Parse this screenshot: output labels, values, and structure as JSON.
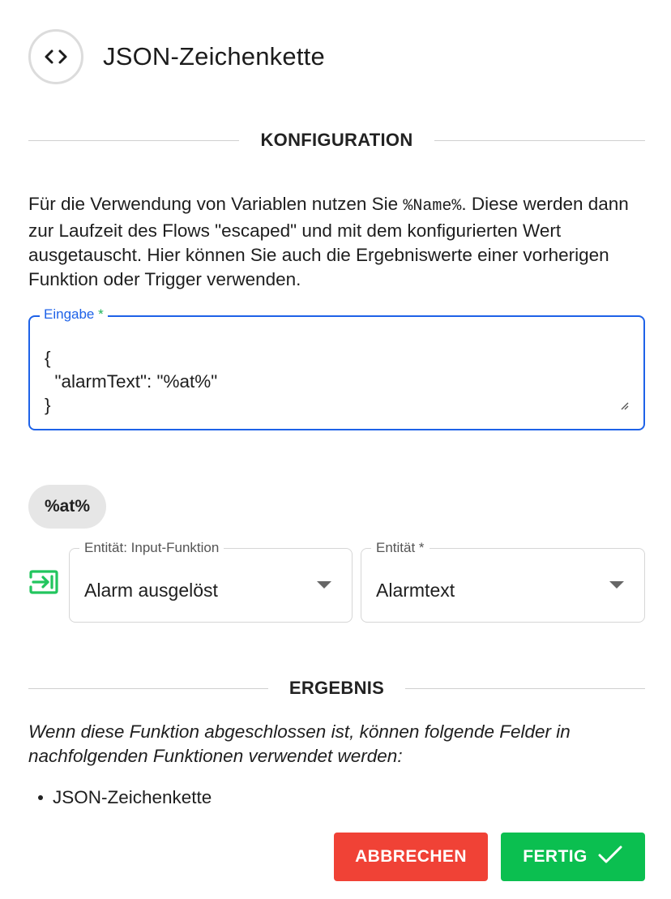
{
  "header": {
    "title": "JSON-Zeichenkette",
    "icon": "code-brackets-icon"
  },
  "config_section": {
    "label": "KONFIGURATION"
  },
  "description": {
    "text_before": "Für die Verwendung von Variablen nutzen Sie ",
    "code": "%Name%",
    "text_after": ". Diese werden dann zur Laufzeit des Flows \"escaped\" und mit dem konfigurierten Wert ausgetauscht. Hier können Sie auch die Ergebniswerte einer vorherigen Funktion oder Trigger verwenden."
  },
  "input_field": {
    "label": "Eingabe",
    "required_marker": "*",
    "value": "{\n  \"alarmText\": \"%at%\"\n}",
    "border_color": "#1e62e8"
  },
  "variable_chip": {
    "label": "%at%"
  },
  "mapping": {
    "icon": "input-arrow-icon",
    "icon_color": "#22c55e",
    "entity_function": {
      "label": "Entität: Input-Funktion",
      "value": "Alarm ausgelöst"
    },
    "entity": {
      "label": "Entität *",
      "value": "Alarmtext"
    }
  },
  "result_section": {
    "label": "ERGEBNIS",
    "description": "Wenn diese Funktion abgeschlossen ist, können folgende Felder in nachfolgenden Funktionen verwendet werden:",
    "fields": [
      "JSON-Zeichenkette"
    ]
  },
  "buttons": {
    "cancel_label": "ABBRECHEN",
    "cancel_color": "#f04236",
    "done_label": "FERTIG",
    "done_color": "#0bbf50"
  }
}
